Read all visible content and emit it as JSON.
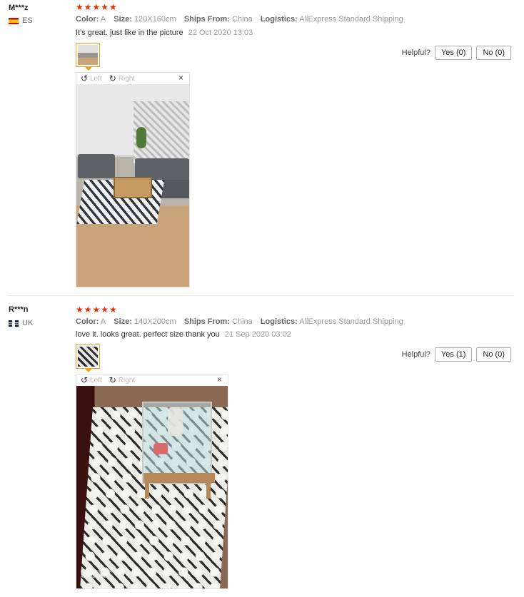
{
  "reviews": [
    {
      "user": "M***z",
      "country": "ES",
      "stars": "★★★★★",
      "meta": {
        "color_label": "Color:",
        "color": "A",
        "size_label": "Size:",
        "size": "120X160cm",
        "ships_label": "Ships From:",
        "ships": "China",
        "logistics_label": "Logistics:",
        "logistics": "AliExpress Standard Shipping"
      },
      "text": "It's great. just like in the picture",
      "date": "22 Oct 2020 13:03",
      "helpful_label": "Helpful?",
      "yes": "Yes (0)",
      "no": "No (0)",
      "viewer": {
        "left": "Left",
        "right": "Right",
        "close": "×"
      }
    },
    {
      "user": "R***n",
      "country": "UK",
      "stars": "★★★★★",
      "meta": {
        "color_label": "Color:",
        "color": "A",
        "size_label": "Size:",
        "size": "140X200cm",
        "ships_label": "Ships From:",
        "ships": "China",
        "logistics_label": "Logistics:",
        "logistics": "AliExpress Standard Shipping"
      },
      "text": "love it. looks great. perfect size thank you",
      "date": "21 Sep 2020 03:02",
      "helpful_label": "Helpful?",
      "yes": "Yes (1)",
      "no": "No (0)",
      "viewer": {
        "left": "Left",
        "right": "Right",
        "close": "×"
      },
      "photo_watermark": "REDMI NOTE 9 PRO\nAI QUAD CAMERA"
    }
  ],
  "colors": {
    "star": "#e62e04",
    "thumb_border": "#f0a020"
  }
}
